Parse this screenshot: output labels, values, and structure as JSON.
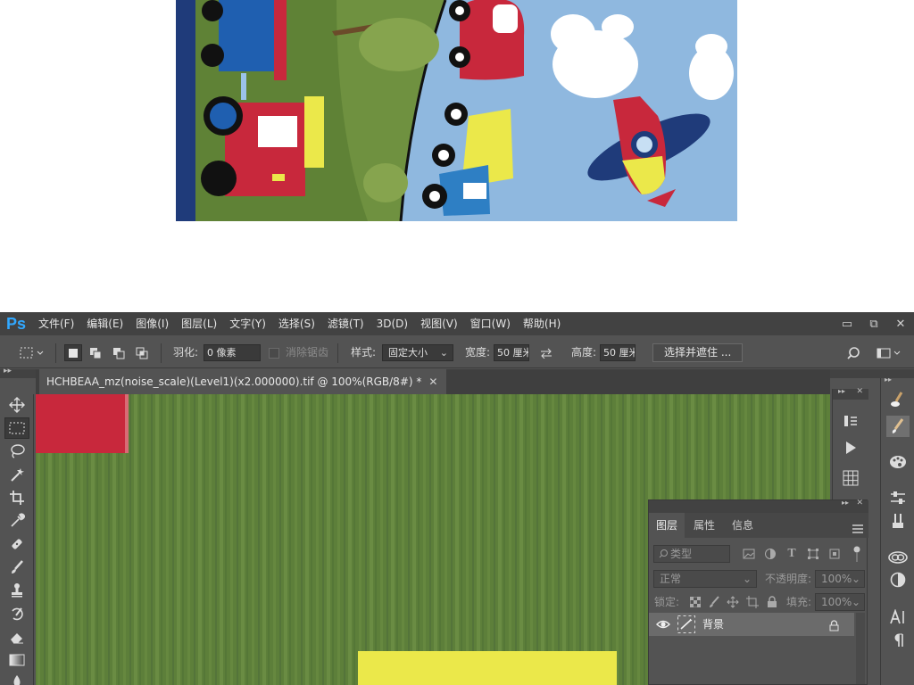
{
  "app": {
    "logo": "Ps"
  },
  "menu": [
    "文件(F)",
    "编辑(E)",
    "图像(I)",
    "图层(L)",
    "文字(Y)",
    "选择(S)",
    "滤镜(T)",
    "3D(D)",
    "视图(V)",
    "窗口(W)",
    "帮助(H)"
  ],
  "window_controls": {
    "minimize": "▭",
    "restore": "⧉",
    "close": "✕"
  },
  "options_bar": {
    "feather_label": "羽化:",
    "feather_value": "0 像素",
    "antialias_label": "消除锯齿",
    "style_label": "样式:",
    "style_value": "固定大小",
    "width_label": "宽度:",
    "width_value": "50 厘米",
    "height_label": "高度:",
    "height_value": "50 厘米",
    "select_mask_button": "选择并遮住 ..."
  },
  "document": {
    "tab_title": "HCHBEAA_mz(noise_scale)(Level1)(x2.000000).tif @ 100%(RGB/8#) *",
    "close": "✕"
  },
  "panel_controls": {
    "collapse": "▸▸",
    "close": "✕"
  },
  "layers_panel": {
    "tabs": [
      "图层",
      "属性",
      "信息"
    ],
    "filter_placeholder": "类型",
    "blend_mode": "正常",
    "opacity_label": "不透明度:",
    "opacity_value": "100%",
    "lock_label": "锁定:",
    "fill_label": "填充:",
    "fill_value": "100%",
    "layers": [
      {
        "name": "背景",
        "visible": true,
        "locked": true
      }
    ]
  },
  "colors": {
    "accent_ps": "#31a8ff",
    "ui_dark": "#424242",
    "ui_mid": "#535353",
    "canvas_green": "#5d7f3a",
    "toy_red": "#c8283c",
    "toy_yellow": "#ebe84a",
    "sky": "#8fb8df",
    "navy": "#1f3b7a"
  }
}
